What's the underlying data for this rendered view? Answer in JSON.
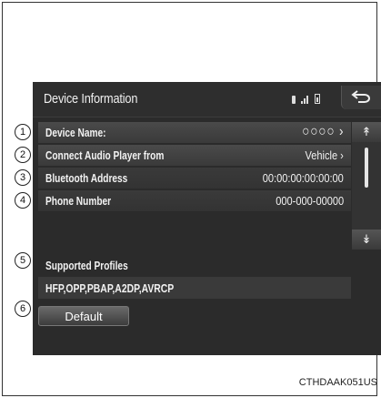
{
  "screen": {
    "title": "Device Information",
    "rows": [
      {
        "label": "Device Name:",
        "value": "○○○○ ›"
      },
      {
        "label": "Connect Audio Player from",
        "value": "Vehicle ›"
      },
      {
        "label": "Bluetooth Address",
        "value": "00:00:00:00:00:00"
      },
      {
        "label": "Phone Number",
        "value": "000-000-00000"
      }
    ],
    "profiles_label": "Supported Profiles",
    "profiles_value": "HFP,OPP,PBAP,A2DP,AVRCP",
    "default_label": "Default",
    "scroll_up": "↟",
    "scroll_down": "↡"
  },
  "callouts": [
    "1",
    "2",
    "3",
    "4",
    "5",
    "6"
  ],
  "caption": "CTHDAAK051US"
}
